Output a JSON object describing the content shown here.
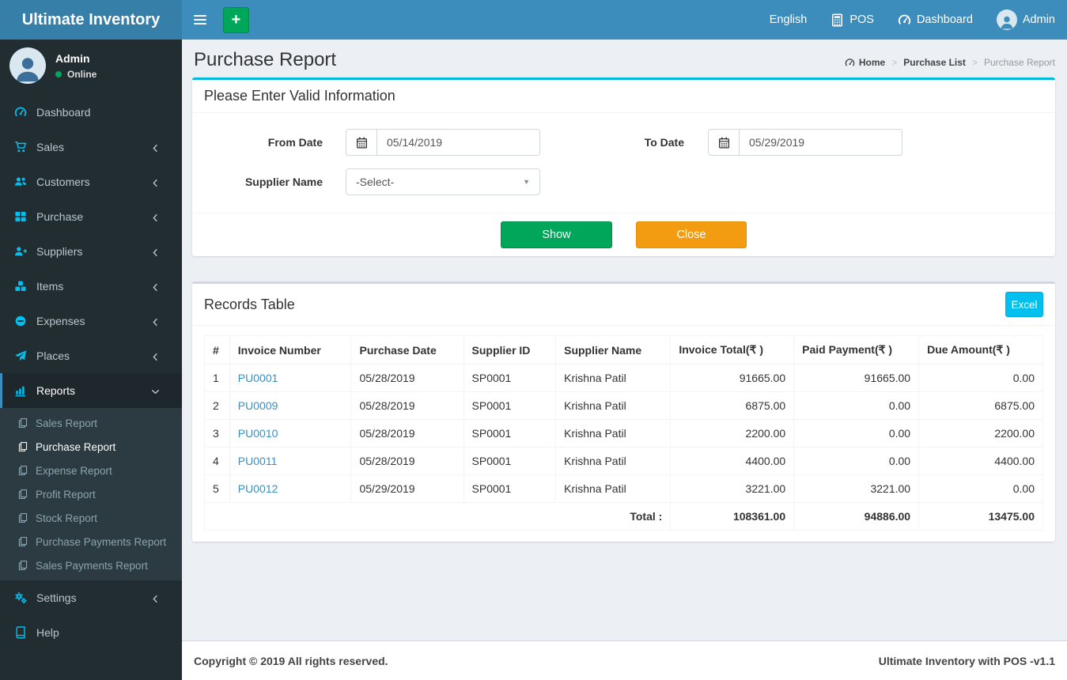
{
  "app": {
    "title": "Ultimate Inventory",
    "copyright": "Copyright © 2019 All rights reserved.",
    "version_label": "Ultimate Inventory with POS -v1.1"
  },
  "navbar": {
    "language": "English",
    "pos_label": "POS",
    "dashboard_label": "Dashboard",
    "user_label": "Admin"
  },
  "sidebar": {
    "user": {
      "name": "Admin",
      "status": "Online"
    },
    "items": [
      {
        "label": "Dashboard"
      },
      {
        "label": "Sales"
      },
      {
        "label": "Customers"
      },
      {
        "label": "Purchase"
      },
      {
        "label": "Suppliers"
      },
      {
        "label": "Items"
      },
      {
        "label": "Expenses"
      },
      {
        "label": "Places"
      },
      {
        "label": "Reports"
      },
      {
        "label": "Settings"
      },
      {
        "label": "Help"
      }
    ],
    "reports_submenu": [
      {
        "label": "Sales Report"
      },
      {
        "label": "Purchase Report"
      },
      {
        "label": "Expense Report"
      },
      {
        "label": "Profit Report"
      },
      {
        "label": "Stock Report"
      },
      {
        "label": "Purchase Payments Report"
      },
      {
        "label": "Sales Payments Report"
      }
    ]
  },
  "page": {
    "title": "Purchase Report",
    "breadcrumb": [
      "Home",
      "Purchase List",
      "Purchase Report"
    ]
  },
  "filter_form": {
    "heading": "Please Enter Valid Information",
    "from_date_label": "From Date",
    "from_date_value": "05/14/2019",
    "to_date_label": "To Date",
    "to_date_value": "05/29/2019",
    "supplier_label": "Supplier Name",
    "supplier_value": "-Select-",
    "show_button": "Show",
    "close_button": "Close"
  },
  "records": {
    "heading": "Records Table",
    "excel_button": "Excel",
    "columns": [
      "#",
      "Invoice Number",
      "Purchase Date",
      "Supplier ID",
      "Supplier Name",
      "Invoice Total(₹ )",
      "Paid Payment(₹ )",
      "Due Amount(₹ )"
    ],
    "rows": [
      [
        "1",
        "PU0001",
        "05/28/2019",
        "SP0001",
        "Krishna Patil",
        "91665.00",
        "91665.00",
        "0.00"
      ],
      [
        "2",
        "PU0009",
        "05/28/2019",
        "SP0001",
        "Krishna Patil",
        "6875.00",
        "0.00",
        "6875.00"
      ],
      [
        "3",
        "PU0010",
        "05/28/2019",
        "SP0001",
        "Krishna Patil",
        "2200.00",
        "0.00",
        "2200.00"
      ],
      [
        "4",
        "PU0011",
        "05/28/2019",
        "SP0001",
        "Krishna Patil",
        "4400.00",
        "0.00",
        "4400.00"
      ],
      [
        "5",
        "PU0012",
        "05/29/2019",
        "SP0001",
        "Krishna Patil",
        "3221.00",
        "3221.00",
        "0.00"
      ]
    ],
    "total_label": "Total :",
    "totals": [
      "108361.00",
      "94886.00",
      "13475.00"
    ]
  },
  "colors": {
    "navbar": "#3c8dbc",
    "logo_bg": "#367fa9",
    "sidebar_bg": "#222d32",
    "accent_cyan": "#00c0ef",
    "success_green": "#00a65a",
    "warning_orange": "#f39c12",
    "link_blue": "#3c8dbc"
  }
}
